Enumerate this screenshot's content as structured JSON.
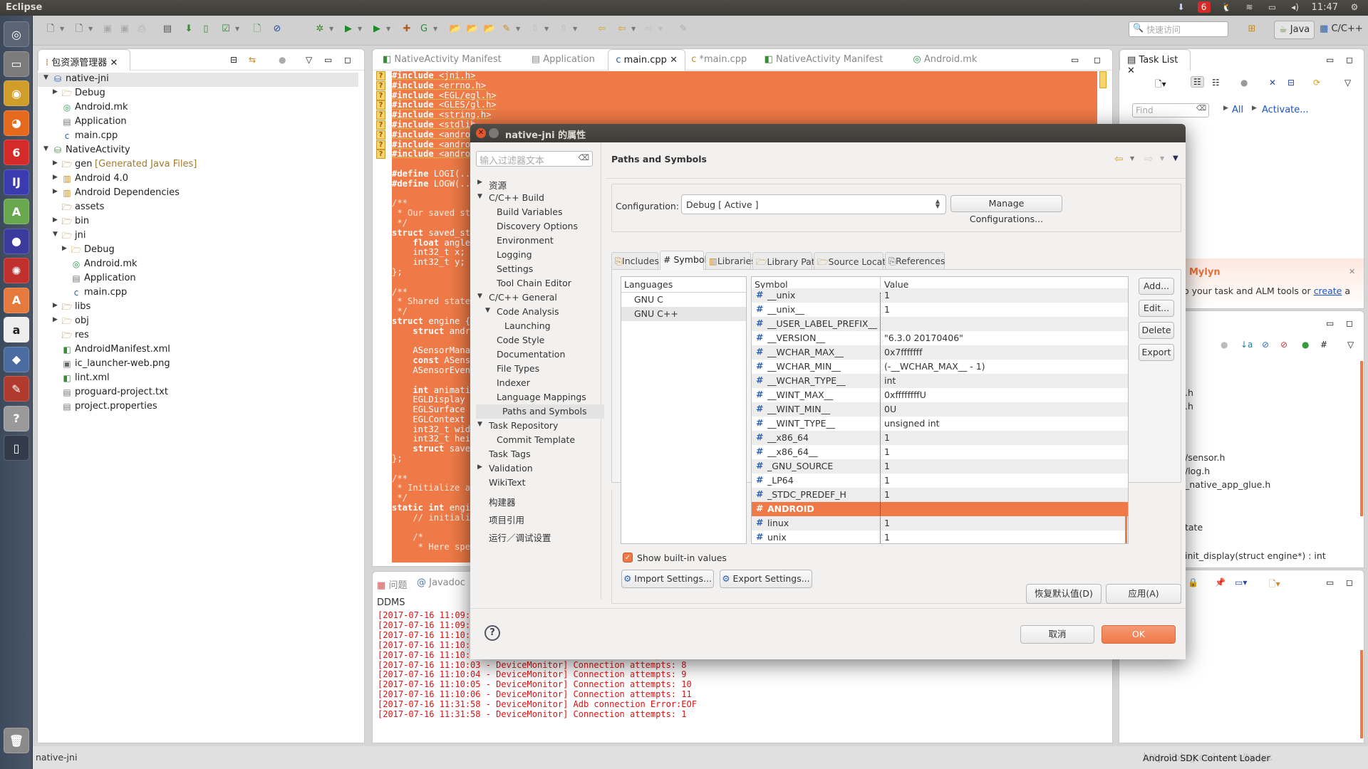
{
  "window": {
    "title": "Eclipse",
    "clock": "11:47"
  },
  "tray_icons": [
    "download-icon",
    "netease-music-icon",
    "qq-icon",
    "wifi-icon",
    "battery-icon",
    "volume-icon",
    "clock",
    "settings-gear-icon"
  ],
  "launcher": [
    {
      "name": "ubuntu-dash-icon",
      "color": "#5a6474",
      "glyph": "◎"
    },
    {
      "name": "files-icon",
      "color": "#7b7b7b",
      "glyph": "▭"
    },
    {
      "name": "chrome-icon",
      "color": "#d19d2a",
      "glyph": "◉"
    },
    {
      "name": "firefox-icon",
      "color": "#e66a1e",
      "glyph": "◕"
    },
    {
      "name": "netease-music-icon",
      "color": "#d42a2a",
      "glyph": "6"
    },
    {
      "name": "intellij-icon",
      "color": "#3b3bb0",
      "glyph": "IJ"
    },
    {
      "name": "android-studio-icon",
      "color": "#6aa84f",
      "glyph": "A"
    },
    {
      "name": "eclipse-icon",
      "color": "#3b3b9e",
      "glyph": "●"
    },
    {
      "name": "network-app-icon",
      "color": "#c0302c",
      "glyph": "✺"
    },
    {
      "name": "software-center-icon",
      "color": "#e6793c",
      "glyph": "A"
    },
    {
      "name": "amazon-icon",
      "color": "#eeeeee",
      "glyph": "a"
    },
    {
      "name": "virtualbox-icon",
      "color": "#4a6ca0",
      "glyph": "◆"
    },
    {
      "name": "system-settings-icon",
      "color": "#b03a2e",
      "glyph": "✎"
    },
    {
      "name": "help-icon",
      "color": "#9a9a9a",
      "glyph": "?"
    },
    {
      "name": "device-icon",
      "color": "#333b4a",
      "glyph": "▯"
    },
    {
      "name": "trash-icon",
      "color": "#8a8a8a",
      "glyph": "🗑"
    }
  ],
  "toolbar": {
    "quick_access_placeholder": "快速访问",
    "perspectives": [
      "Java",
      "C/C++"
    ]
  },
  "package_explorer": {
    "title": "包资源管理器",
    "items": [
      {
        "label": "native-jni",
        "level": 0,
        "twisty": "open",
        "icon": "c-project-icon",
        "selected": true
      },
      {
        "label": "Debug",
        "level": 1,
        "twisty": "closed",
        "icon": "folder-icon"
      },
      {
        "label": "Android.mk",
        "level": 1,
        "twisty": "",
        "icon": "makefile-icon"
      },
      {
        "label": "Application",
        "level": 1,
        "twisty": "",
        "icon": "text-file-icon"
      },
      {
        "label": "main.cpp",
        "level": 1,
        "twisty": "",
        "icon": "cpp-file-warning-icon"
      },
      {
        "label": "NativeActivity",
        "level": 0,
        "twisty": "open",
        "icon": "android-project-icon"
      },
      {
        "label": "gen",
        "suffix": "[Generated Java Files]",
        "level": 1,
        "twisty": "closed",
        "icon": "source-folder-icon"
      },
      {
        "label": "Android 4.0",
        "level": 1,
        "twisty": "closed",
        "icon": "library-icon"
      },
      {
        "label": "Android Dependencies",
        "level": 1,
        "twisty": "closed",
        "icon": "library-icon"
      },
      {
        "label": "assets",
        "level": 1,
        "twisty": "",
        "icon": "package-folder-icon"
      },
      {
        "label": "bin",
        "level": 1,
        "twisty": "closed",
        "icon": "package-folder-icon"
      },
      {
        "label": "jni",
        "level": 1,
        "twisty": "open",
        "icon": "folder-icon"
      },
      {
        "label": "Debug",
        "level": 2,
        "twisty": "closed",
        "icon": "folder-icon"
      },
      {
        "label": "Android.mk",
        "level": 2,
        "twisty": "",
        "icon": "makefile-icon"
      },
      {
        "label": "Application",
        "level": 2,
        "twisty": "",
        "icon": "text-file-icon"
      },
      {
        "label": "main.cpp",
        "level": 2,
        "twisty": "",
        "icon": "cpp-file-icon"
      },
      {
        "label": "libs",
        "level": 1,
        "twisty": "closed",
        "icon": "package-folder-icon"
      },
      {
        "label": "obj",
        "level": 1,
        "twisty": "closed",
        "icon": "folder-icon"
      },
      {
        "label": "res",
        "level": 1,
        "twisty": "",
        "icon": "package-folder-icon"
      },
      {
        "label": "AndroidManifest.xml",
        "level": 1,
        "twisty": "",
        "icon": "android-xml-icon"
      },
      {
        "label": "ic_launcher-web.png",
        "level": 1,
        "twisty": "",
        "icon": "image-file-icon"
      },
      {
        "label": "lint.xml",
        "level": 1,
        "twisty": "",
        "icon": "android-xml-icon"
      },
      {
        "label": "proguard-project.txt",
        "level": 1,
        "twisty": "",
        "icon": "text-file-icon"
      },
      {
        "label": "project.properties",
        "level": 1,
        "twisty": "",
        "icon": "text-file-icon"
      }
    ]
  },
  "editor": {
    "tabs": [
      {
        "label": "NativeActivity Manifest",
        "active": false
      },
      {
        "label": "Application",
        "active": false
      },
      {
        "label": "main.cpp",
        "active": true
      },
      {
        "label": "*main.cpp",
        "active": false
      },
      {
        "label": "NativeActivity Manifest",
        "active": false
      },
      {
        "label": "Android.mk",
        "active": false
      }
    ],
    "code_lines": [
      "#include <jni.h>",
      "#include <errno.h>",
      "#include <EGL/egl.h>",
      "#include <GLES/gl.h>",
      "#include <string.h>",
      "#include <stdlib",
      "#include <androi",
      "#include <androi",
      "#include <androi",
      "",
      "#define LOGI(...",
      "#define LOGW(...",
      "",
      "/**",
      " * Our saved sta",
      " */",
      "struct saved_sta",
      "    float angle;",
      "    int32_t x;",
      "    int32_t y;",
      "};",
      "",
      "/**",
      " * Shared state",
      " */",
      "struct engine {",
      "    struct andro",
      "",
      "    ASensorManag",
      "    const ASenso",
      "    ASensorEvent",
      "",
      "    int animatin",
      "    EGLDisplay d",
      "    EGLSurface s",
      "    EGLContext c",
      "    int32_t widt",
      "    int32_t heig",
      "    struct saved",
      "};",
      "",
      "/**",
      " * Initialize an",
      " */",
      "static int engin",
      "    // initializ",
      "",
      "    /*",
      "     * Here spec"
    ],
    "warning_markers": 9
  },
  "bottom_panel": {
    "tabs": [
      "问题",
      "Javadoc"
    ],
    "console_name": "DDMS",
    "log_lines": [
      "[2017-07-16 11:09:5",
      "[2017-07-16 11:09:5",
      "[2017-07-16 11:10:0",
      "[2017-07-16 11:10:0",
      "[2017-07-16 11:10:02 - DeviceMonitor] Connection attempts: 7",
      "[2017-07-16 11:10:03 - DeviceMonitor] Connection attempts: 8",
      "[2017-07-16 11:10:04 - DeviceMonitor] Connection attempts: 9",
      "[2017-07-16 11:10:05 - DeviceMonitor] Connection attempts: 10",
      "[2017-07-16 11:10:06 - DeviceMonitor] Connection attempts: 11",
      "[2017-07-16 11:31:58 - DeviceMonitor] Adb connection Error:EOF",
      "[2017-07-16 11:31:58 - DeviceMonitor] Connection attempts: 1"
    ]
  },
  "task_list": {
    "title": "Task List",
    "find_placeholder": "Find",
    "all_link": "All",
    "activate_link": "Activate...",
    "mylyn_title": "Mylyn",
    "mylyn_text": "o your task and ALM tools or",
    "mylyn_link": "create",
    "mylyn_suffix": "a"
  },
  "outline": {
    "items": [
      ".h",
      ".h",
      "/sensor.h",
      "/log.h",
      "_native_app_glue.h",
      "tate",
      "init_display(struct engine*) : int"
    ]
  },
  "dialog": {
    "title": "native-jni 的属性",
    "filter_placeholder": "输入过滤器文本",
    "nav": [
      {
        "label": "资源",
        "level": 0,
        "twisty": "closed"
      },
      {
        "label": "C/C++ Build",
        "level": 0,
        "twisty": "open"
      },
      {
        "label": "Build Variables",
        "level": 1
      },
      {
        "label": "Discovery Options",
        "level": 1
      },
      {
        "label": "Environment",
        "level": 1
      },
      {
        "label": "Logging",
        "level": 1
      },
      {
        "label": "Settings",
        "level": 1
      },
      {
        "label": "Tool Chain Editor",
        "level": 1
      },
      {
        "label": "C/C++ General",
        "level": 0,
        "twisty": "open"
      },
      {
        "label": "Code Analysis",
        "level": 1,
        "twisty": "open"
      },
      {
        "label": "Launching",
        "level": 2
      },
      {
        "label": "Code Style",
        "level": 1
      },
      {
        "label": "Documentation",
        "level": 1
      },
      {
        "label": "File Types",
        "level": 1
      },
      {
        "label": "Indexer",
        "level": 1
      },
      {
        "label": "Language Mappings",
        "level": 1
      },
      {
        "label": "Paths and Symbols",
        "level": 1,
        "selected": true
      },
      {
        "label": "Task Repository",
        "level": 0,
        "twisty": "open"
      },
      {
        "label": "Commit Template",
        "level": 1
      },
      {
        "label": "Task Tags",
        "level": 0
      },
      {
        "label": "Validation",
        "level": 0,
        "twisty": "closed"
      },
      {
        "label": "WikiText",
        "level": 0
      },
      {
        "label": "构建器",
        "level": 0
      },
      {
        "label": "项目引用",
        "level": 0
      },
      {
        "label": "运行／调试设置",
        "level": 0
      }
    ],
    "page_title": "Paths and Symbols",
    "configuration_label": "Configuration:",
    "configuration_value": "Debug  [ Active ]",
    "manage_configurations": "Manage Configurations...",
    "tabs": [
      {
        "label": "Includes",
        "icon": "includes-icon"
      },
      {
        "label": "# Symbols",
        "icon": "",
        "active": true
      },
      {
        "label": "Libraries",
        "icon": "libraries-icon"
      },
      {
        "label": "Library Paths",
        "icon": "library-paths-icon"
      },
      {
        "label": "Source Location",
        "icon": "source-location-icon"
      },
      {
        "label": "References",
        "icon": "references-icon"
      }
    ],
    "languages_header": "Languages",
    "languages": [
      {
        "label": "GNU C"
      },
      {
        "label": "GNU C++",
        "selected": true
      }
    ],
    "symbol_header": "Symbol",
    "value_header": "Value",
    "symbols": [
      {
        "name": "__unix",
        "value": "1"
      },
      {
        "name": "__unix__",
        "value": "1"
      },
      {
        "name": "__USER_LABEL_PREFIX__",
        "value": ""
      },
      {
        "name": "__VERSION__",
        "value": "\"6.3.0 20170406\""
      },
      {
        "name": "__WCHAR_MAX__",
        "value": "0x7fffffff"
      },
      {
        "name": "__WCHAR_MIN__",
        "value": "(-__WCHAR_MAX__ - 1)"
      },
      {
        "name": "__WCHAR_TYPE__",
        "value": "int"
      },
      {
        "name": "__WINT_MAX__",
        "value": "0xffffffffU"
      },
      {
        "name": "__WINT_MIN__",
        "value": "0U"
      },
      {
        "name": "__WINT_TYPE__",
        "value": "unsigned int"
      },
      {
        "name": "__x86_64",
        "value": "1"
      },
      {
        "name": "__x86_64__",
        "value": "1"
      },
      {
        "name": "_GNU_SOURCE",
        "value": "1"
      },
      {
        "name": "_LP64",
        "value": "1"
      },
      {
        "name": "_STDC_PREDEF_H",
        "value": "1"
      },
      {
        "name": "ANDROID",
        "value": "",
        "selected": true
      },
      {
        "name": "linux",
        "value": "1"
      },
      {
        "name": "unix",
        "value": "1"
      }
    ],
    "side_buttons": [
      "Add...",
      "Edit...",
      "Delete",
      "Export"
    ],
    "show_builtin_label": "Show built-in values",
    "show_builtin_checked": true,
    "import_settings": "Import Settings...",
    "export_settings": "Export Settings...",
    "restore_defaults": "恢复默认值(D)",
    "apply": "应用(A)",
    "cancel": "取消",
    "ok": "OK"
  },
  "status_bar": {
    "left": "native-jni",
    "right": "Android SDK Content Loader",
    "watermark": "http://blog.csdn.net/tydyz"
  },
  "colors": {
    "accent": "#ef7a47",
    "selection": "#ef7a47",
    "console_error": "#e01010",
    "link": "#1a55c4"
  }
}
